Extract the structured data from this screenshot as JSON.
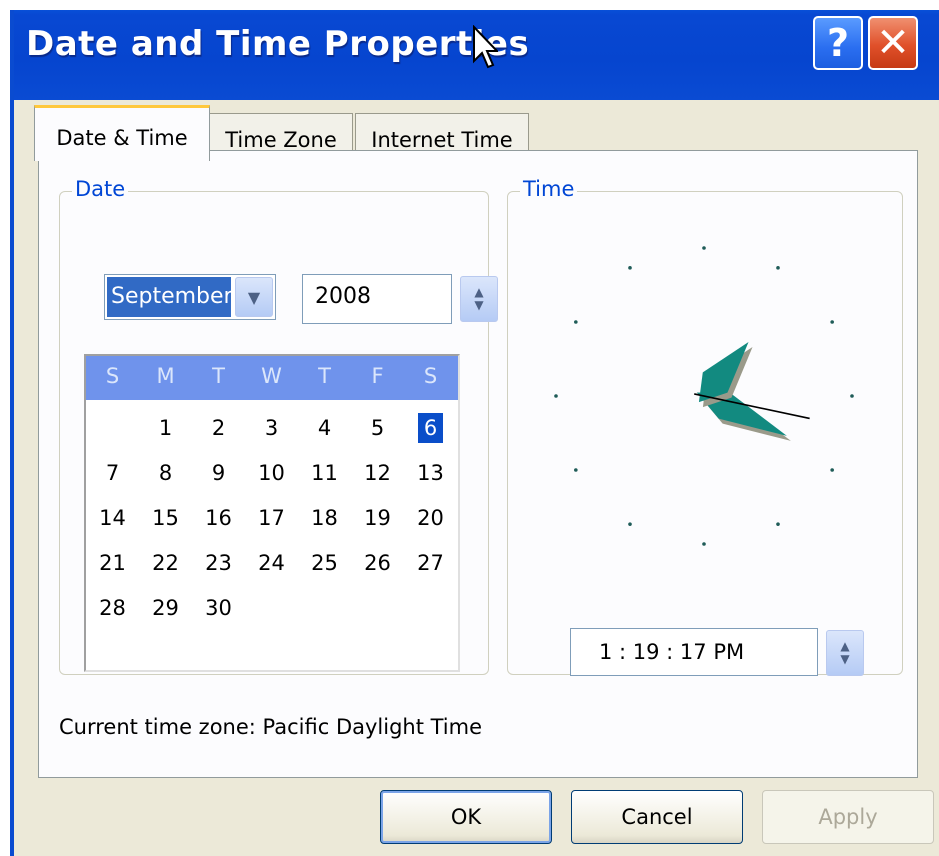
{
  "window": {
    "title": "Date and Time Properties",
    "help_label": "?",
    "close_label": "✕"
  },
  "tabs": [
    {
      "label": "Date & Time",
      "active": true
    },
    {
      "label": "Time Zone",
      "active": false
    },
    {
      "label": "Internet Time",
      "active": false
    }
  ],
  "date_group": {
    "label": "Date",
    "month_value": "September",
    "year_value": "2008",
    "weekday_headers": [
      "S",
      "M",
      "T",
      "W",
      "T",
      "F",
      "S"
    ],
    "weeks": [
      [
        "",
        "1",
        "2",
        "3",
        "4",
        "5",
        "6"
      ],
      [
        "7",
        "8",
        "9",
        "10",
        "11",
        "12",
        "13"
      ],
      [
        "14",
        "15",
        "16",
        "17",
        "18",
        "19",
        "20"
      ],
      [
        "21",
        "22",
        "23",
        "24",
        "25",
        "26",
        "27"
      ],
      [
        "28",
        "29",
        "30",
        "",
        "",
        "",
        ""
      ]
    ],
    "selected_day": "6"
  },
  "time_group": {
    "label": "Time",
    "time_value": "1 : 19 : 17 PM",
    "clock": {
      "hour": 1,
      "minute": 19,
      "second": 17
    }
  },
  "timezone_text": "Current time zone:  Pacific Daylight Time",
  "buttons": {
    "ok": "OK",
    "cancel": "Cancel",
    "apply": "Apply"
  },
  "colors": {
    "titlebar": "#0645cf",
    "hand_fill": "#128a80",
    "selection": "#316ac5",
    "group_label": "#0046d5"
  }
}
